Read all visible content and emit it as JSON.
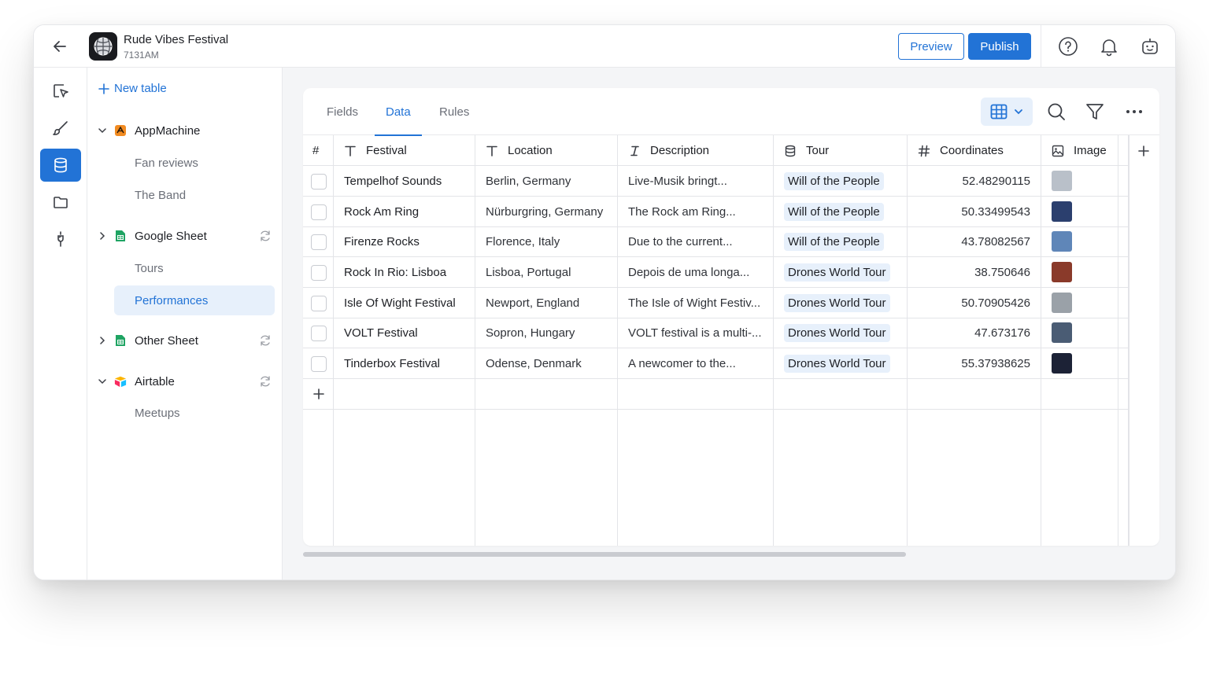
{
  "app": {
    "name": "Rude Vibes Festival",
    "id": "7131AM"
  },
  "toolbar": {
    "preview_label": "Preview",
    "publish_label": "Publish"
  },
  "sidebar": {
    "new_table_label": "New table",
    "groups": [
      {
        "label": "AppMachine",
        "tables": [
          "Fan reviews",
          "The Band"
        ]
      },
      {
        "label": "Google Sheet",
        "tables": [
          "Tours",
          "Performances"
        ]
      },
      {
        "label": "Other Sheet",
        "tables": []
      },
      {
        "label": "Airtable",
        "tables": [
          "Meetups"
        ]
      }
    ],
    "active_table": "Performances"
  },
  "tabs": [
    "Fields",
    "Data",
    "Rules"
  ],
  "active_tab": "Data",
  "table": {
    "headers": {
      "row_num": "#",
      "festival": "Festival",
      "location": "Location",
      "description": "Description",
      "tour": "Tour",
      "coordinates": "Coordinates",
      "image": "Image"
    },
    "rows": [
      {
        "festival": "Tempelhof Sounds",
        "location": "Berlin, Germany",
        "description": "Live-Musik bringt...",
        "tour": "Will of the People",
        "coordinates": "52.48290115",
        "image_color": "#b9c0c9"
      },
      {
        "festival": "Rock Am Ring",
        "location": "Nürburgring, Germany",
        "description": "The Rock am Ring...",
        "tour": "Will of the People",
        "coordinates": "50.33499543",
        "image_color": "#2b3f6e"
      },
      {
        "festival": "Firenze Rocks",
        "location": "Florence, Italy",
        "description": "Due to the current...",
        "tour": "Will of the People",
        "coordinates": "43.78082567",
        "image_color": "#5f86b8"
      },
      {
        "festival": "Rock In Rio: Lisboa",
        "location": "Lisboa, Portugal",
        "description": "Depois de uma longa...",
        "tour": "Drones World Tour",
        "coordinates": "38.750646",
        "image_color": "#8a3a2a"
      },
      {
        "festival": "Isle Of Wight Festival",
        "location": "Newport, England",
        "description": "The Isle of Wight Festiv...",
        "tour": "Drones World Tour",
        "coordinates": "50.70905426",
        "image_color": "#9aa1a8"
      },
      {
        "festival": "VOLT Festival",
        "location": "Sopron, Hungary",
        "description": "VOLT festival is a multi-...",
        "tour": "Drones World Tour",
        "coordinates": "47.673176",
        "image_color": "#4a5c74"
      },
      {
        "festival": "Tinderbox Festival",
        "location": "Odense, Denmark",
        "description": "A newcomer to the...",
        "tour": "Drones World Tour",
        "coordinates": "55.37938625",
        "image_color": "#1c2236"
      }
    ]
  },
  "colors": {
    "accent": "#2273d6",
    "accent_light": "#e7f0fb",
    "border": "#e3e4e8"
  }
}
